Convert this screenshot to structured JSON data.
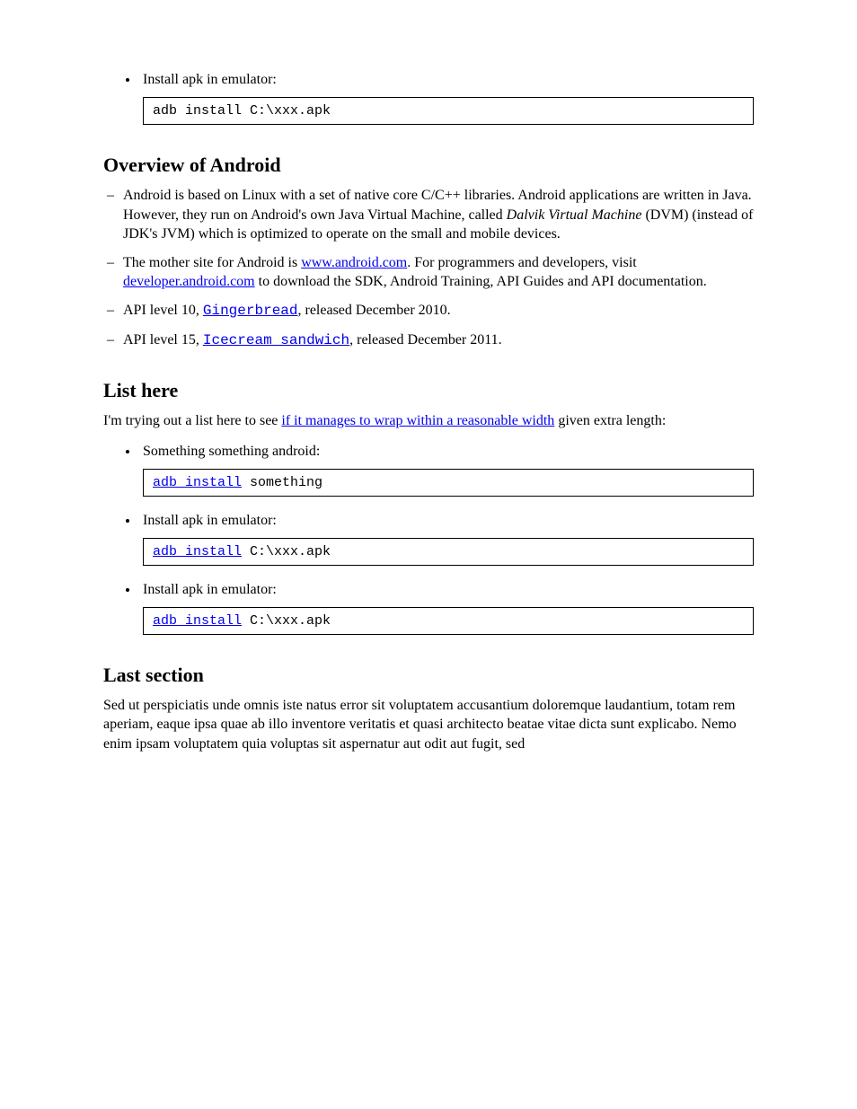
{
  "item1": {
    "label": "Install apk in emulator:",
    "code": "adb install C:\\xxx.apk"
  },
  "section1": {
    "heading": "Overview of Android",
    "items": [
      {
        "pre": "Android is based on Linux with a set of native core C/C++ libraries. Android applications are written in Java. However, they run on Android's own Java Virtual Machine, called ",
        "emph": "Dalvik Virtual Machine",
        "post": " (DVM) (instead of JDK's JVM) which is optimized to operate on the small and mobile devices."
      },
      {
        "pre": "The mother site for Android is ",
        "link": "www.android.com",
        "post": ". For programmers and developers, visit ",
        "link2": "developer.android.com",
        "post2": " to download the SDK, Android Training, API Guides and API documentation."
      },
      {
        "pre": "API level 10, ",
        "link": "Gingerbread",
        "post": ", released December 2010."
      },
      {
        "pre": "API level 15, ",
        "link": "Icecream sandwich",
        "post": ", released December 2011."
      }
    ]
  },
  "section2": {
    "heading": "List here",
    "intro": {
      "pre": "I'm trying out a list here to see ",
      "link": "if it manages to wrap within a reasonable width",
      "post": " given extra length:"
    },
    "items": [
      {
        "label": "Something something android:",
        "pre_code": "",
        "link_code": "adb install",
        "post_code": " something"
      },
      {
        "label": "Install apk in emulator:",
        "pre_code": "",
        "link_code": "adb install",
        "post_code": " C:\\xxx.apk"
      },
      {
        "label": "Install apk in emulator:",
        "pre_code": "",
        "link_code": "adb install",
        "post_code": " C:\\xxx.apk"
      }
    ]
  },
  "section3": {
    "heading": "Last section",
    "para": "Sed ut perspiciatis unde omnis iste natus error sit voluptatem accusantium doloremque laudantium, totam rem aperiam, eaque ipsa quae ab illo inventore veritatis et quasi architecto beatae vitae dicta sunt explicabo. Nemo enim ipsam voluptatem quia voluptas sit aspernatur aut odit aut fugit, sed"
  }
}
